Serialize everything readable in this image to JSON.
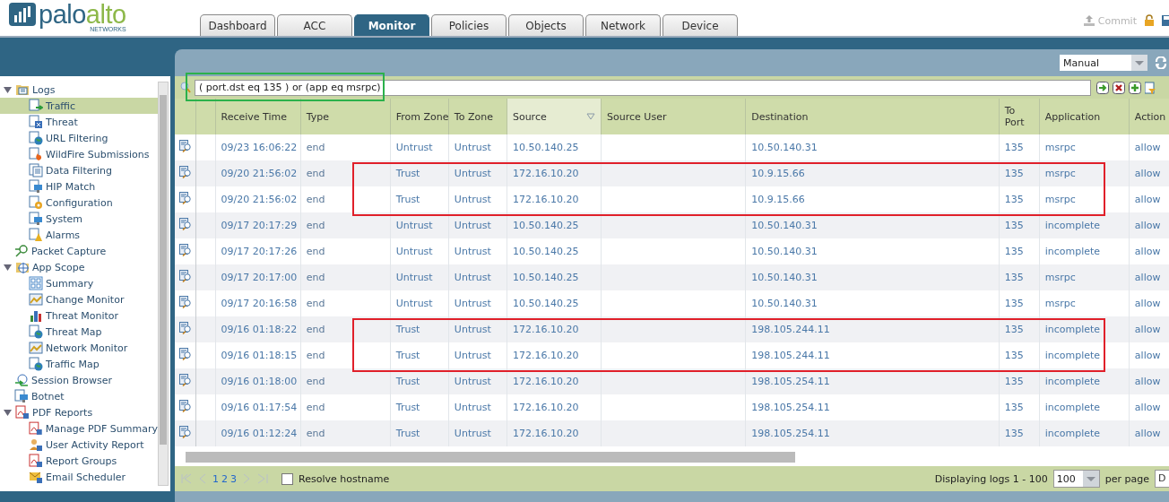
{
  "logo": {
    "word_1": "palo",
    "word_2": "alto",
    "tagline": "NETWORKS"
  },
  "tabs": [
    {
      "label": "Dashboard",
      "selected": false
    },
    {
      "label": "ACC",
      "selected": false
    },
    {
      "label": "Monitor",
      "selected": true
    },
    {
      "label": "Policies",
      "selected": false
    },
    {
      "label": "Objects",
      "selected": false
    },
    {
      "label": "Network",
      "selected": false
    },
    {
      "label": "Device",
      "selected": false
    }
  ],
  "commit": {
    "label": "Commit",
    "disabled": true
  },
  "sidebar": {
    "items": [
      {
        "label": "Logs",
        "kind": "logs",
        "expanded": true,
        "selected": false,
        "children": [
          {
            "label": "Traffic",
            "kind": "traffic",
            "selected": true
          },
          {
            "label": "Threat",
            "kind": "threat",
            "selected": false
          },
          {
            "label": "URL Filtering",
            "kind": "globe",
            "selected": false
          },
          {
            "label": "WildFire Submissions",
            "kind": "fire",
            "selected": false
          },
          {
            "label": "Data Filtering",
            "kind": "doc",
            "selected": false
          },
          {
            "label": "HIP Match",
            "kind": "monitor",
            "selected": false
          },
          {
            "label": "Configuration",
            "kind": "gear",
            "selected": false
          },
          {
            "label": "System",
            "kind": "monitor",
            "selected": false
          },
          {
            "label": "Alarms",
            "kind": "bell",
            "selected": false
          }
        ]
      },
      {
        "label": "Packet Capture",
        "kind": "magnifier",
        "selected": false
      },
      {
        "label": "App Scope",
        "kind": "scope",
        "expanded": true,
        "selected": false,
        "children": [
          {
            "label": "Summary",
            "kind": "grid",
            "selected": false
          },
          {
            "label": "Change Monitor",
            "kind": "chart",
            "selected": false
          },
          {
            "label": "Threat Monitor",
            "kind": "bars",
            "selected": false
          },
          {
            "label": "Threat Map",
            "kind": "globe",
            "selected": false
          },
          {
            "label": "Network Monitor",
            "kind": "chart",
            "selected": false
          },
          {
            "label": "Traffic Map",
            "kind": "globe",
            "selected": false
          }
        ]
      },
      {
        "label": "Session Browser",
        "kind": "arrows",
        "selected": false
      },
      {
        "label": "Botnet",
        "kind": "monitor",
        "selected": false
      },
      {
        "label": "PDF Reports",
        "kind": "pdf",
        "expanded": true,
        "selected": false,
        "children": [
          {
            "label": "Manage PDF Summary",
            "kind": "pdf",
            "selected": false
          },
          {
            "label": "User Activity Report",
            "kind": "user",
            "selected": false
          },
          {
            "label": "Report Groups",
            "kind": "pdf",
            "selected": false
          },
          {
            "label": "Email Scheduler",
            "kind": "mail",
            "selected": false
          }
        ]
      }
    ]
  },
  "refresh_select": {
    "value": "Manual"
  },
  "filter": {
    "value": "( port.dst eq 135 ) or (app eq msrpc)",
    "boxed": true
  },
  "table": {
    "columns": [
      {
        "label": "Receive Time",
        "hovered": false
      },
      {
        "label": "Type",
        "hovered": false
      },
      {
        "label": "From Zone",
        "hovered": false
      },
      {
        "label": "To Zone",
        "hovered": false
      },
      {
        "label": "Source",
        "hovered": true
      },
      {
        "label": "Source User",
        "hovered": false
      },
      {
        "label": "Destination",
        "hovered": false
      },
      {
        "label": "To Port",
        "hovered": false
      },
      {
        "label": "Application",
        "hovered": false
      },
      {
        "label": "Action",
        "hovered": false
      }
    ],
    "rows": [
      {
        "cells": [
          "09/23 16:06:22",
          "end",
          "Untrust",
          "Untrust",
          "10.50.140.25",
          "",
          "10.50.140.31",
          "135",
          "msrpc",
          "allow"
        ],
        "boxed": false
      },
      {
        "cells": [
          "09/20 21:56:02",
          "end",
          "Trust",
          "Untrust",
          "172.16.10.20",
          "",
          "10.9.15.66",
          "135",
          "msrpc",
          "allow"
        ],
        "boxed": true
      },
      {
        "cells": [
          "09/20 21:56:02",
          "end",
          "Trust",
          "Untrust",
          "172.16.10.20",
          "",
          "10.9.15.66",
          "135",
          "msrpc",
          "allow"
        ],
        "boxed": true
      },
      {
        "cells": [
          "09/17 20:17:29",
          "end",
          "Untrust",
          "Untrust",
          "10.50.140.25",
          "",
          "10.50.140.31",
          "135",
          "incomplete",
          "allow"
        ],
        "boxed": false
      },
      {
        "cells": [
          "09/17 20:17:26",
          "end",
          "Untrust",
          "Untrust",
          "10.50.140.25",
          "",
          "10.50.140.31",
          "135",
          "incomplete",
          "allow"
        ],
        "boxed": false
      },
      {
        "cells": [
          "09/17 20:17:00",
          "end",
          "Untrust",
          "Untrust",
          "10.50.140.25",
          "",
          "10.50.140.31",
          "135",
          "msrpc",
          "allow"
        ],
        "boxed": false
      },
      {
        "cells": [
          "09/17 20:16:58",
          "end",
          "Untrust",
          "Untrust",
          "10.50.140.25",
          "",
          "10.50.140.31",
          "135",
          "msrpc",
          "allow"
        ],
        "boxed": false
      },
      {
        "cells": [
          "09/16 01:18:22",
          "end",
          "Trust",
          "Untrust",
          "172.16.10.20",
          "",
          "198.105.244.11",
          "135",
          "incomplete",
          "allow"
        ],
        "boxed": true
      },
      {
        "cells": [
          "09/16 01:18:15",
          "end",
          "Trust",
          "Untrust",
          "172.16.10.20",
          "",
          "198.105.244.11",
          "135",
          "incomplete",
          "allow"
        ],
        "boxed": true
      },
      {
        "cells": [
          "09/16 01:18:00",
          "end",
          "Trust",
          "Untrust",
          "172.16.10.20",
          "",
          "198.105.254.11",
          "135",
          "incomplete",
          "allow"
        ],
        "boxed": false
      },
      {
        "cells": [
          "09/16 01:17:54",
          "end",
          "Trust",
          "Untrust",
          "172.16.10.20",
          "",
          "198.105.254.11",
          "135",
          "incomplete",
          "allow"
        ],
        "boxed": false
      },
      {
        "cells": [
          "09/16 01:12:24",
          "end",
          "Trust",
          "Untrust",
          "172.16.10.20",
          "",
          "198.105.254.11",
          "135",
          "incomplete",
          "allow"
        ],
        "boxed": false
      }
    ]
  },
  "pager": {
    "pages": [
      "1",
      "2",
      "3"
    ],
    "resolve_hostname": {
      "label": "Resolve hostname",
      "checked": false
    },
    "summary": "Displaying logs 1 - 100",
    "page_size": "100",
    "per_page_label": "per page",
    "cut_field": "D"
  }
}
